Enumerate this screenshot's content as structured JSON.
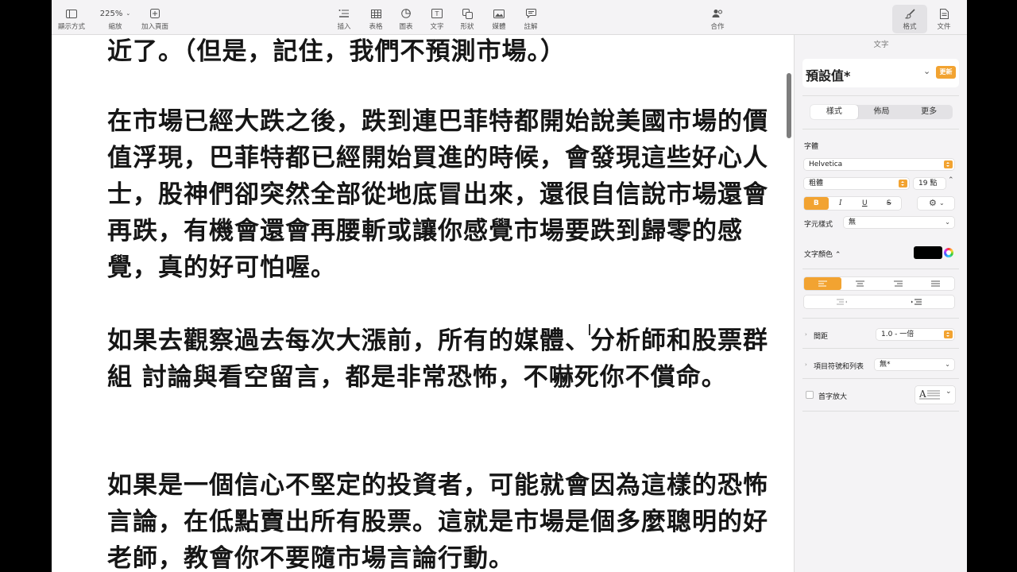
{
  "toolbar": {
    "view": "顯示方式",
    "zoom_value": "225%",
    "zoom": "縮放",
    "add_page": "加入頁面",
    "insert": "插入",
    "table": "表格",
    "chart": "圖表",
    "text": "文字",
    "shape": "形狀",
    "media": "媒體",
    "comment": "註解",
    "collaborate": "合作",
    "format": "格式",
    "document": "文件"
  },
  "document": {
    "paragraphs": [
      "近了。（但是，記住，我們不預測市場。）",
      "在市場已經大跌之後，跌到連巴菲特都開始說美國市場的價值浮現，巴菲特都已經開始買進的時候，會發現這些好心人士，股神們卻突然全部從地底冒出來，還很自信說市場還會再跌，有機會還會再腰斬或讓你感覺市場要跌到歸零的感覺，真的好可怕喔。",
      "如果去觀察過去每次大漲前，所有的媒體、分析師和股票群組 討論與看空留言，都是非常恐怖，不嚇死你不償命。",
      "如果是一個信心不堅定的投資者，可能就會因為這樣的恐怖言論，在低點賣出所有股票。這就是市場是個多麼聰明的好老師，教會你不要隨市場言論行動。"
    ]
  },
  "sidebar": {
    "title": "文字",
    "style_name": "預設值*",
    "update_label": "更新",
    "tabs": [
      "樣式",
      "佈局",
      "更多"
    ],
    "font_label": "字體",
    "font_family": "Helvetica",
    "font_weight": "粗體",
    "font_size": "19 點",
    "format_buttons": [
      "B",
      "I",
      "U",
      "S"
    ],
    "char_style_label": "字元樣式",
    "char_style_value": "無",
    "text_color_label": "文字顏色 ⌃",
    "text_color": "#000000",
    "spacing_label": "間距",
    "spacing_value": "1.0 - 一倍",
    "bullets_label": "項目符號和列表",
    "bullets_value": "無*",
    "dropcap_label": "首字放大"
  },
  "colors": {
    "accent": "#f2a331",
    "toolbar_bg": "#f4f3f5"
  }
}
